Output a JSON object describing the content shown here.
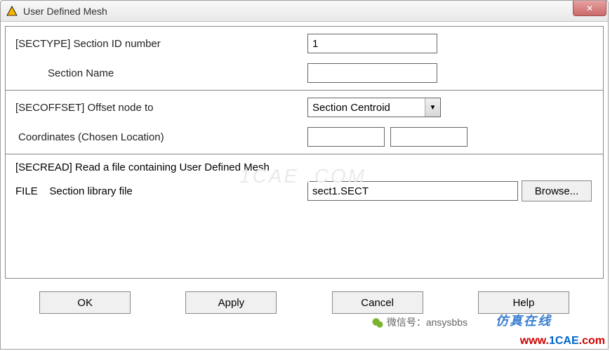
{
  "window": {
    "title": "User Defined Mesh",
    "close_glyph": "✕"
  },
  "sectype": {
    "label": "[SECTYPE] Section ID number",
    "value": "1",
    "name_label": "Section Name",
    "name_value": ""
  },
  "secoffset": {
    "label": "[SECOFFSET] Offset node to",
    "selected": "Section Centroid",
    "coords_label": "Coordinates (Chosen Location)",
    "coord_x": "",
    "coord_y": ""
  },
  "secread": {
    "label": "[SECREAD]   Read a file containing User Defined Mesh",
    "file_label_prefix": "FILE",
    "file_label": "Section library file",
    "file_value": "sect1.SECT",
    "browse_label": "Browse..."
  },
  "buttons": {
    "ok": "OK",
    "apply": "Apply",
    "cancel": "Cancel",
    "help": "Help"
  },
  "watermark": {
    "faint": "1CAE .COM",
    "wx": "微信号：ansysbbs",
    "cn": "仿真在线",
    "url_w": "www.",
    "url_d": "1CAE",
    "url_c": ".com"
  }
}
